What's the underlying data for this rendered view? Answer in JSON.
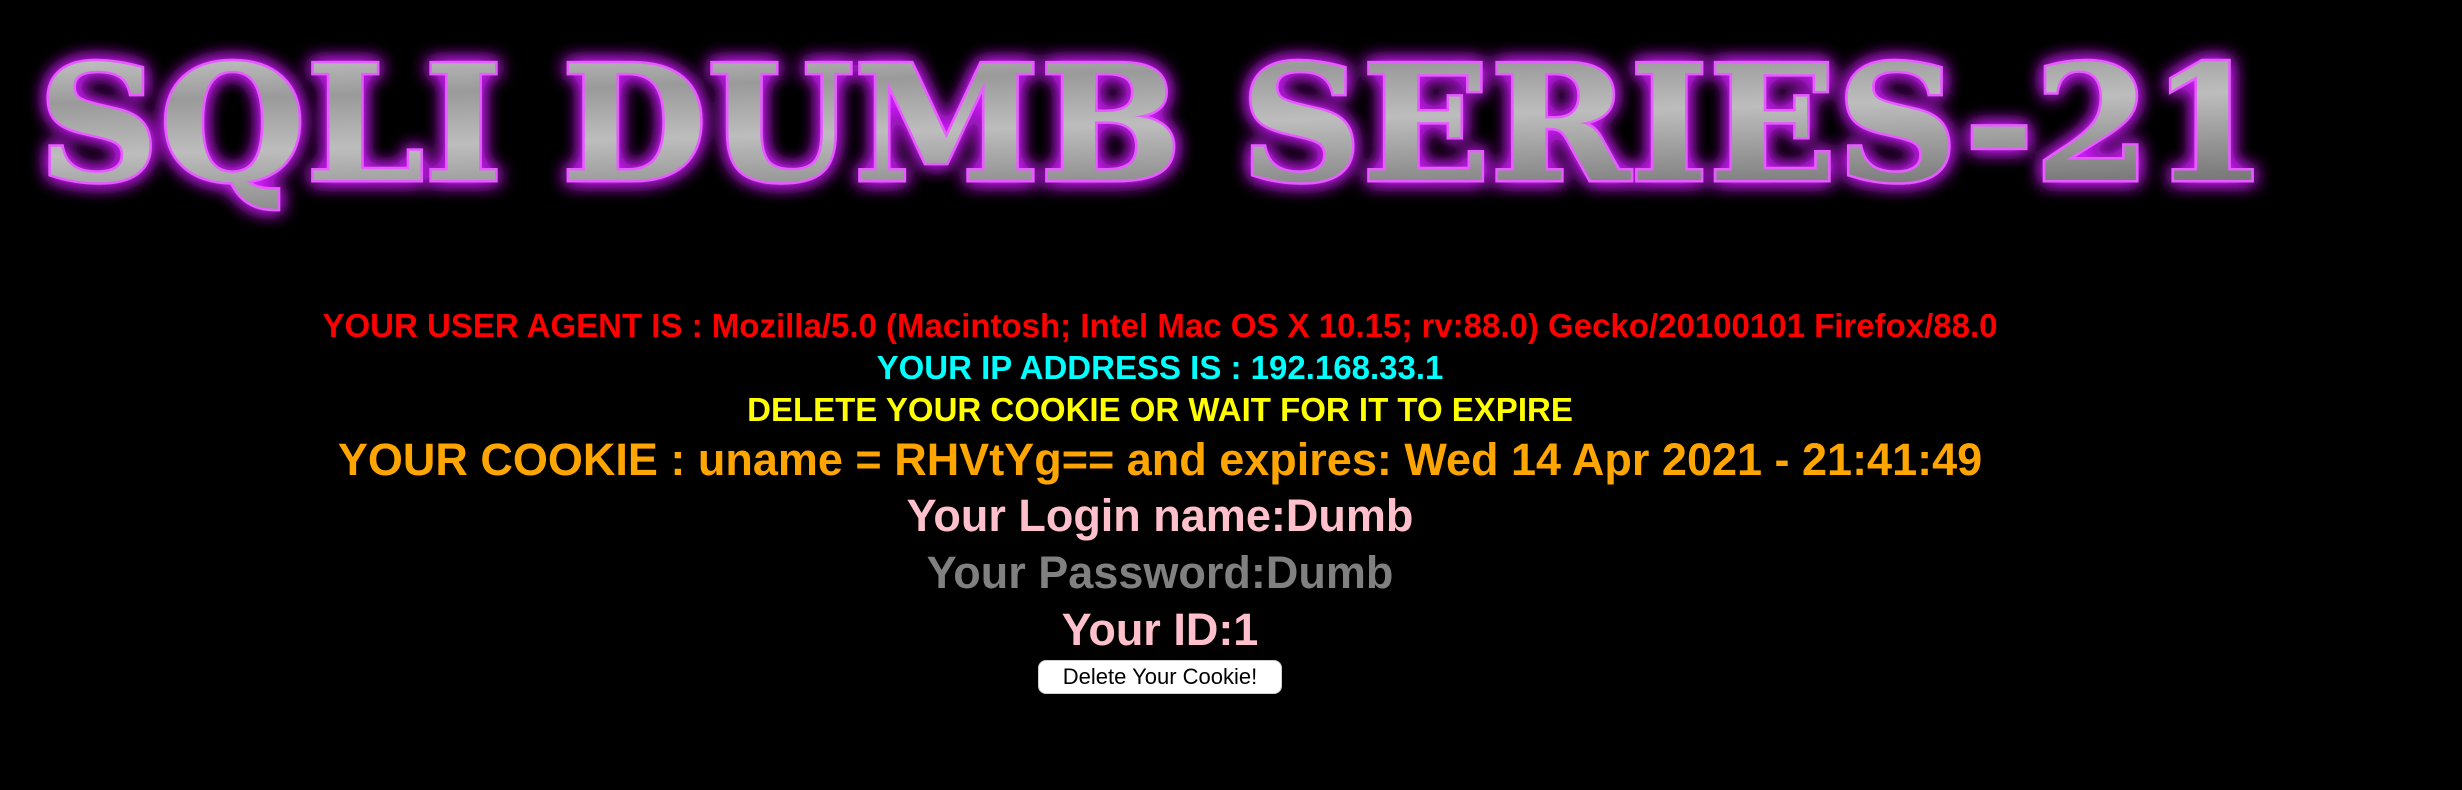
{
  "banner": {
    "title": "SQLI DUMB SERIES-21",
    "glow_color": "#d21fff"
  },
  "info": {
    "user_agent": "YOUR USER AGENT IS : Mozilla/5.0 (Macintosh; Intel Mac OS X 10.15; rv:88.0) Gecko/20100101 Firefox/88.0",
    "ip_address": "YOUR IP ADDRESS IS : 192.168.33.1",
    "delete_notice": "DELETE YOUR COOKIE OR WAIT FOR IT TO EXPIRE",
    "cookie": "YOUR COOKIE : uname = RHVtYg== and expires: Wed 14 Apr 2021 - 21:41:49",
    "login_name": "Your Login name:Dumb",
    "password": "Your Password:Dumb",
    "id": "Your ID:1"
  },
  "actions": {
    "delete_cookie_label": "Delete Your Cookie!"
  },
  "colors": {
    "background": "#000000",
    "user_agent": "#ff0000",
    "ip_address": "#00ffff",
    "delete_notice": "#ffff00",
    "cookie": "#ffa500",
    "login_name": "#ffc0cb",
    "password": "#808080",
    "id": "#ffc0cb"
  }
}
